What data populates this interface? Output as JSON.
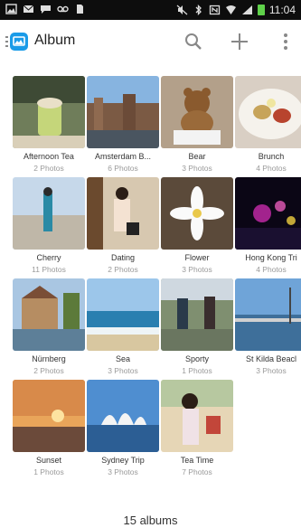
{
  "status_bar": {
    "time": "11:04",
    "icons": [
      "image-icon",
      "mail-icon",
      "chat-icon",
      "voicemail-icon",
      "doc-icon",
      "mute-icon",
      "bluetooth-icon",
      "nfc-icon",
      "wifi-icon",
      "signal-icon",
      "battery-icon"
    ]
  },
  "app_bar": {
    "title": "Album",
    "actions": [
      "search-icon",
      "add-icon",
      "overflow-menu-icon"
    ]
  },
  "albums": [
    {
      "name": "Afternoon Tea",
      "count": "2 Photos"
    },
    {
      "name": "Amsterdam B...",
      "count": "6 Photos"
    },
    {
      "name": "Bear",
      "count": "3 Photos"
    },
    {
      "name": "Brunch",
      "count": "4 Photos"
    },
    {
      "name": "Cherry",
      "count": "11 Photos"
    },
    {
      "name": "Dating",
      "count": "2 Photos"
    },
    {
      "name": "Flower",
      "count": "3 Photos"
    },
    {
      "name": "Hong Kong Tri",
      "count": "4 Photos"
    },
    {
      "name": "Nürnberg",
      "count": "2 Photos"
    },
    {
      "name": "Sea",
      "count": "3 Photos"
    },
    {
      "name": "Sporty",
      "count": "1 Photos"
    },
    {
      "name": "St Kilda Beacl",
      "count": "3 Photos"
    },
    {
      "name": "Sunset",
      "count": "1 Photos"
    },
    {
      "name": "Sydney Trip",
      "count": "3 Photos"
    },
    {
      "name": "Tea Time",
      "count": "7 Photos"
    }
  ],
  "footer": {
    "summary": "15 albums"
  },
  "colors": {
    "accent": "#1a9be8",
    "statusbar": "#0d0d0d",
    "battery": "#5fd14a"
  }
}
